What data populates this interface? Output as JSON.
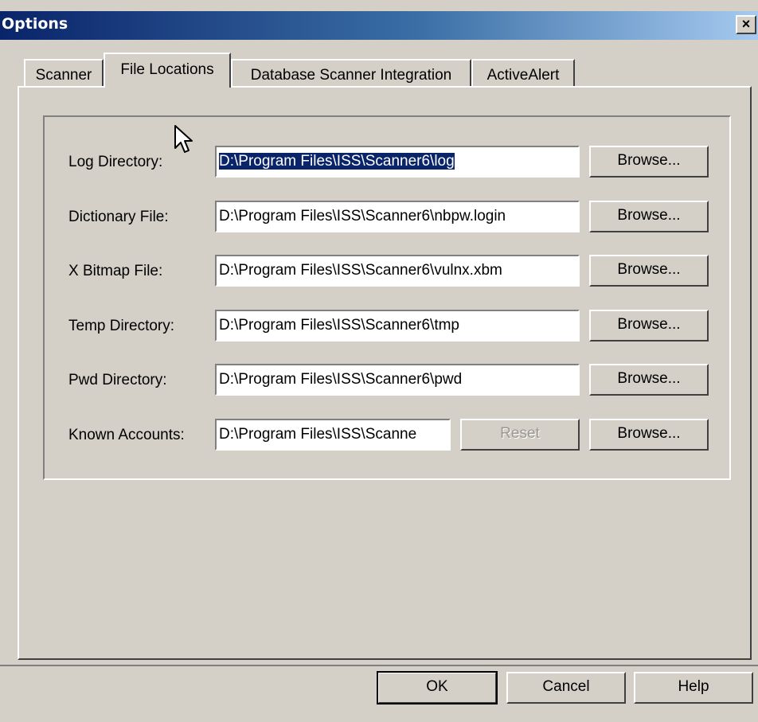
{
  "window": {
    "title": "Options",
    "close_glyph": "×"
  },
  "tabs": [
    {
      "label": "Scanner",
      "active": false
    },
    {
      "label": "File Locations",
      "active": true
    },
    {
      "label": "Database Scanner Integration",
      "active": false
    },
    {
      "label": "ActiveAlert",
      "active": false
    }
  ],
  "fields": [
    {
      "label": "Log Directory:",
      "value": "D:\\Program Files\\ISS\\Scanner6\\log",
      "button": "Browse..."
    },
    {
      "label": "Dictionary File:",
      "value": "D:\\Program Files\\ISS\\Scanner6\\nbpw.login",
      "button": "Browse..."
    },
    {
      "label": "X Bitmap File:",
      "value": "D:\\Program Files\\ISS\\Scanner6\\vulnx.xbm",
      "button": "Browse..."
    },
    {
      "label": "Temp Directory:",
      "value": "D:\\Program Files\\ISS\\Scanner6\\tmp",
      "button": "Browse..."
    },
    {
      "label": "Pwd Directory:",
      "value": "D:\\Program Files\\ISS\\Scanner6\\pwd",
      "button": "Browse..."
    },
    {
      "label": "Known Accounts:",
      "value": "D:\\Program Files\\ISS\\Scanne",
      "button": "Browse...",
      "reset": "Reset"
    }
  ],
  "footer": {
    "ok": "OK",
    "cancel": "Cancel",
    "help": "Help"
  },
  "colors": {
    "face": "#d4d0c8",
    "title_start": "#0a246a",
    "title_end": "#a6caf0",
    "selection": "#0a246a"
  },
  "icons": {
    "close": "close-icon",
    "cursor": "mouse-pointer-icon"
  }
}
